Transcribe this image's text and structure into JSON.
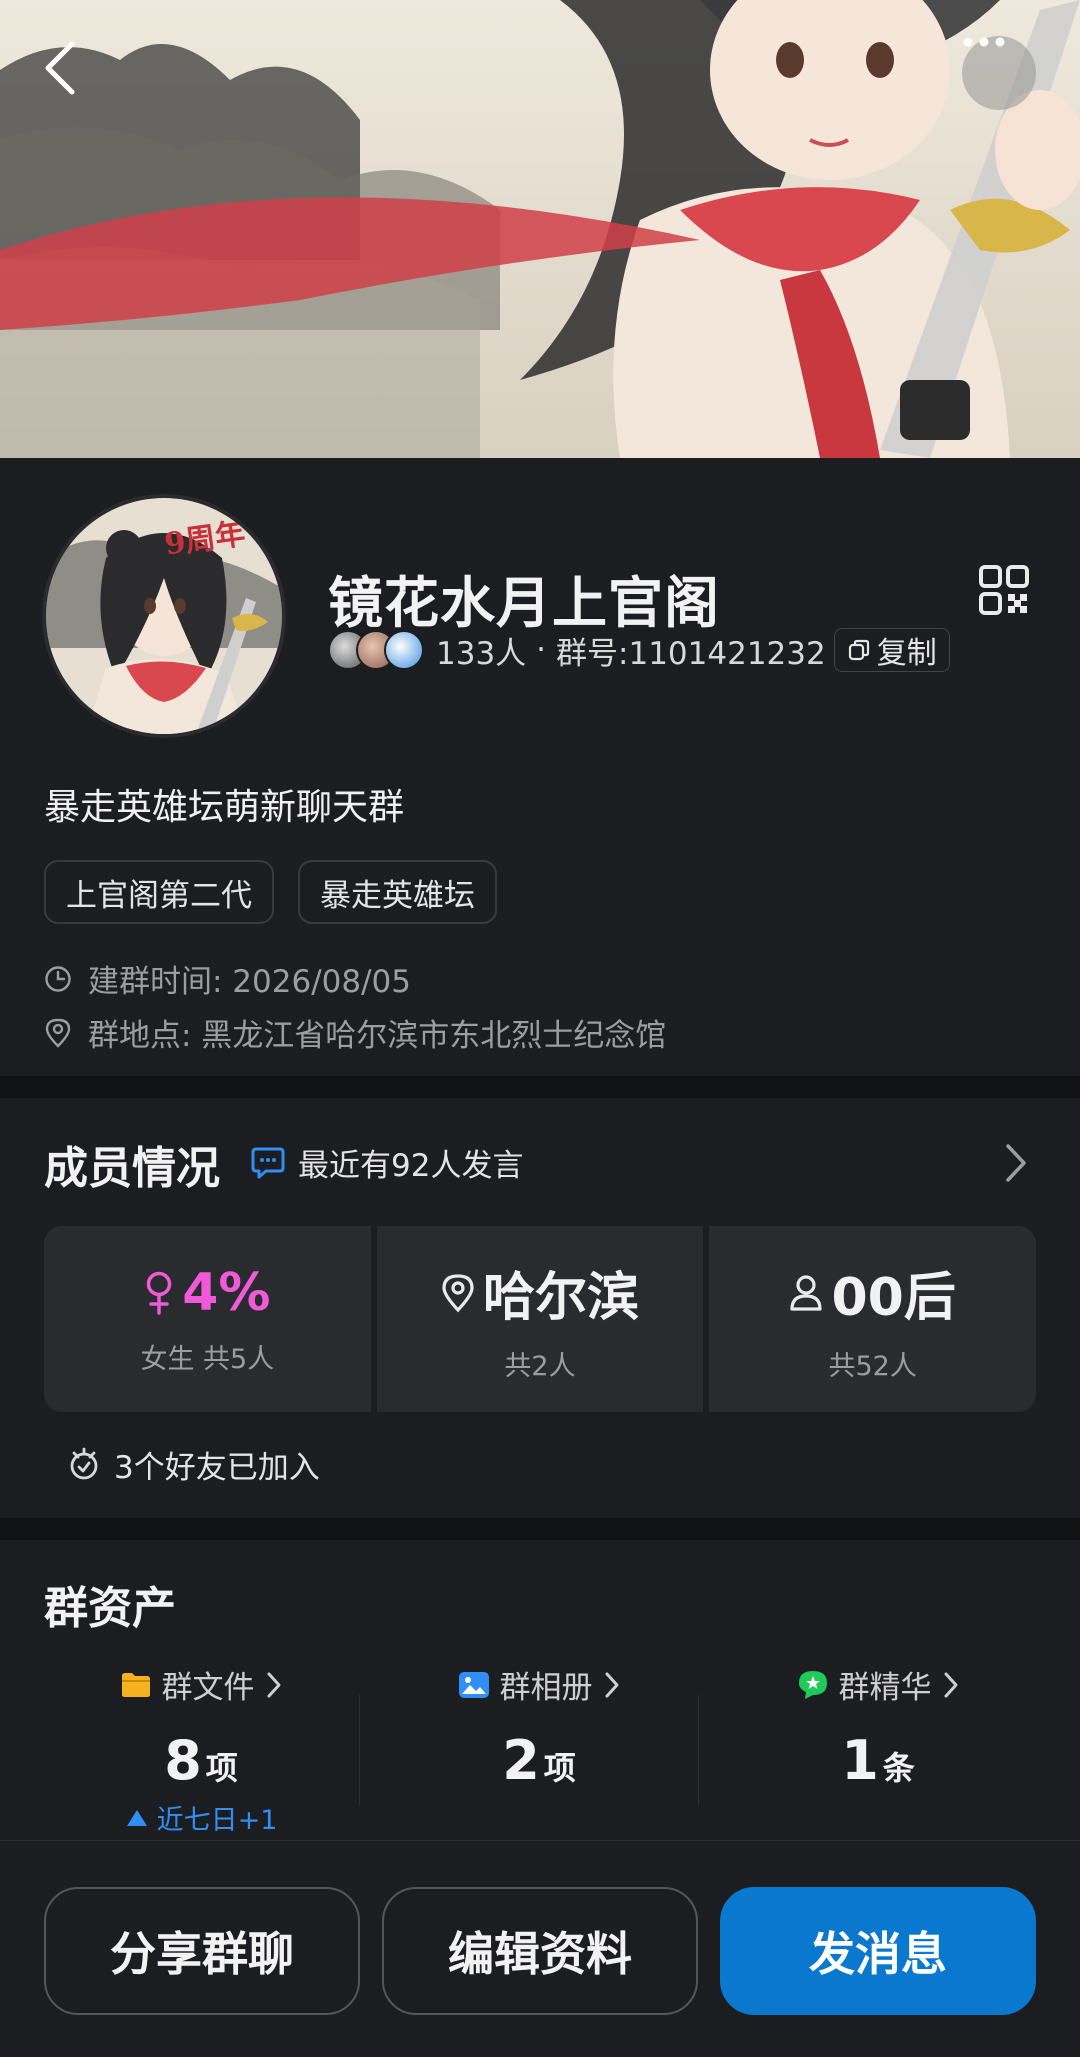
{
  "header": {
    "back_icon": "chevron-left-icon",
    "more_icon": "ellipsis-icon"
  },
  "profile": {
    "avatar_badge": "9周年",
    "name": "镜花水月上官阁",
    "member_count": "133人",
    "separator": "·",
    "group_number": "群号:1101421232",
    "copy_label": "复制",
    "description": "暴走英雄坛萌新聊天群",
    "tags": [
      "上官阁第二代",
      "暴走英雄坛"
    ],
    "created": "建群时间: 2026/08/05",
    "location": "群地点: 黑龙江省哈尔滨市东北烈士纪念馆"
  },
  "members": {
    "title": "成员情况",
    "recent": "最近有92人发言",
    "stats": [
      {
        "main": "4%",
        "sub": "女生 共5人",
        "icon": "female-icon"
      },
      {
        "main": "哈尔滨",
        "sub": "共2人",
        "icon": "location-pin-icon"
      },
      {
        "main": "00后",
        "sub": "共52人",
        "icon": "person-icon"
      }
    ],
    "friends": "3个好友已加入"
  },
  "assets": {
    "title": "群资产",
    "items": [
      {
        "label": "群文件",
        "count": "8",
        "unit": "项",
        "trend": "近七日+1",
        "color": "#f5b21e"
      },
      {
        "label": "群相册",
        "count": "2",
        "unit": "项",
        "color": "#2f8ff5"
      },
      {
        "label": "群精华",
        "count": "1",
        "unit": "条",
        "color": "#1fc95a"
      }
    ]
  },
  "actions": {
    "share": "分享群聊",
    "edit": "编辑资料",
    "send": "发消息"
  },
  "colors": {
    "background": "#1c1d20",
    "primary": "#0a78cf",
    "accent_pink": "#f05ad8",
    "link_blue": "#2f8ff5"
  }
}
